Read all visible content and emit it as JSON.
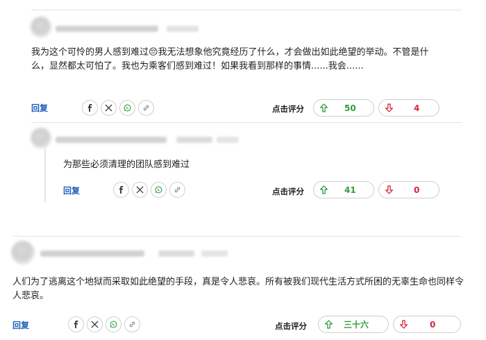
{
  "comments": [
    {
      "text": "我为这个可怜的男人感到难过😔我无法想象他究竟经历了什么，才会做出如此绝望的举动。不管是什么，显然都太可怕了。我也为乘客们感到难过！如果我看到那样的事情......我会......",
      "reply_label": "回复",
      "rate_label": "点击评分",
      "upvotes": "50",
      "downvotes": "4"
    },
    {
      "text": "为那些必须清理的团队感到难过",
      "reply_label": "回复",
      "rate_label": "点击评分",
      "upvotes": "41",
      "downvotes": "0"
    },
    {
      "text": "人们为了逃离这个地狱而采取如此绝望的手段，真是令人悲哀。所有被我们现代生活方式所困的无辜生命也同样令人悲哀。",
      "reply_label": "回复",
      "rate_label": "点击评分",
      "upvotes": "三十六",
      "downvotes": "0"
    }
  ],
  "share_icons": [
    "facebook-icon",
    "x-icon",
    "whatsapp-icon",
    "link-icon"
  ],
  "vote_icons": [
    "arrow-up-icon",
    "arrow-down-icon"
  ],
  "colors": {
    "link": "#1f5fbf",
    "upvote": "#2e9e3a",
    "downvote": "#d7263d",
    "border": "#cfcfcf"
  }
}
